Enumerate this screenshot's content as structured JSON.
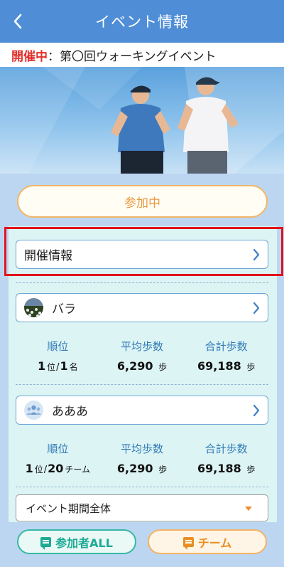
{
  "header": {
    "title": "イベント情報",
    "back_icon": "chevron-left-icon"
  },
  "event": {
    "status": "開催中",
    "separator": "：",
    "name": "第〇回ウォーキングイベント"
  },
  "join_button": {
    "label": "参加中"
  },
  "info_button": {
    "label": "開催情報",
    "icon": "chevron-right-icon"
  },
  "personal": {
    "name": "バラ",
    "avatar_icon": "flower-field-avatar",
    "stats": {
      "rank_label": "順位",
      "rank": "1",
      "rank_unit": "位",
      "rank_sep": "/",
      "rank_total": "1",
      "rank_total_unit": "名",
      "avg_label": "平均歩数",
      "avg": "6,290",
      "avg_unit": "歩",
      "total_label": "合計歩数",
      "total": "69,188",
      "total_unit": "歩"
    }
  },
  "team": {
    "name": "あああ",
    "avatar_icon": "group-icon",
    "stats": {
      "rank_label": "順位",
      "rank": "1",
      "rank_unit": "位",
      "rank_sep": "/",
      "rank_total": "20",
      "rank_total_unit": "チーム",
      "avg_label": "平均歩数",
      "avg": "6,290",
      "avg_unit": "歩",
      "total_label": "合計歩数",
      "total": "69,188",
      "total_unit": "歩"
    }
  },
  "period_select": {
    "value": "イベント期間全体"
  },
  "bottom_tabs": {
    "participants": {
      "label": "参加者ALL",
      "icon": "chat-icon"
    },
    "team": {
      "label": "チーム",
      "icon": "chat-icon"
    }
  },
  "colors": {
    "header": "#4f8ed7",
    "status": "#e0312d",
    "accent_orange": "#e99a43",
    "accent_teal": "#1ea994",
    "highlight": "#e3141b"
  }
}
